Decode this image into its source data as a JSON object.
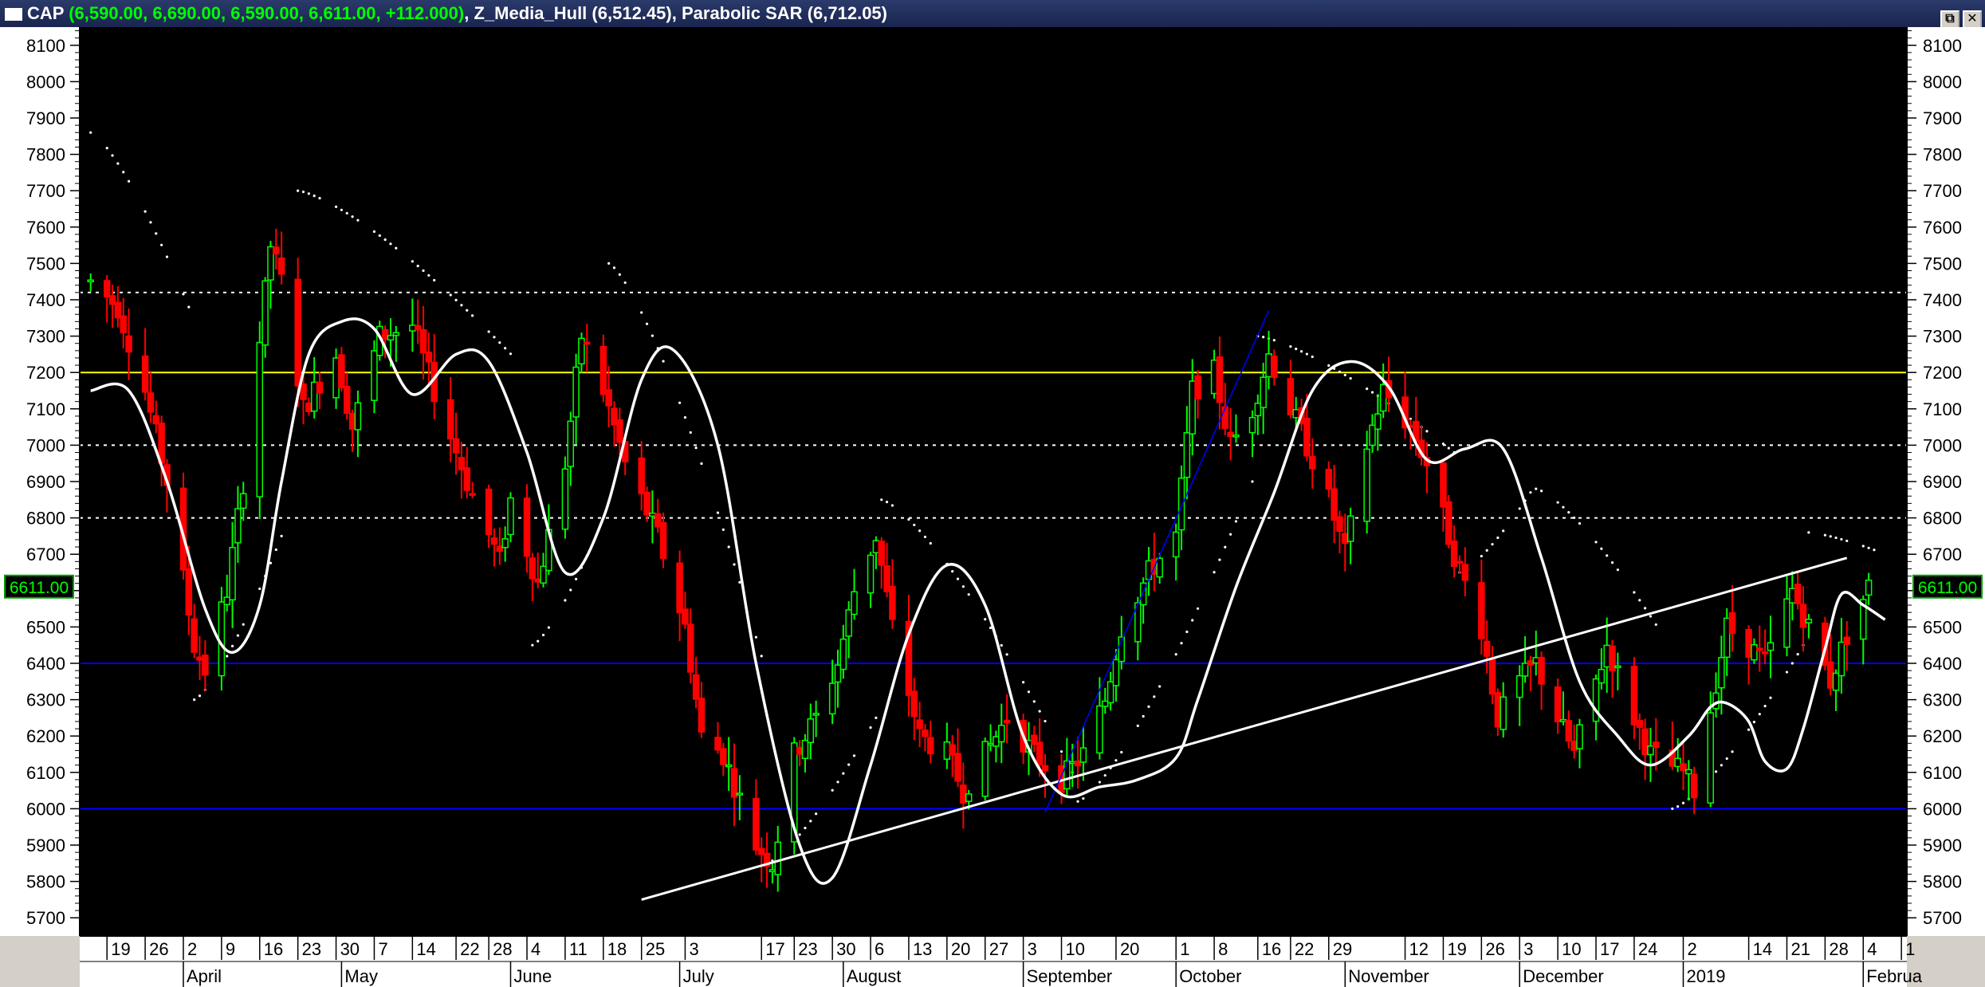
{
  "window": {
    "symbol": "CAP",
    "ohlc_text": "(6,590.00, 6,690.00, 6,590.00, 6,611.00, +112.000)",
    "indicator1_name": "Z_Media_Hull",
    "indicator1_value": "(6,512.45)",
    "indicator2_name": "Parabolic SAR",
    "indicator2_value": "(6,712.05)",
    "separator": ",",
    "restore_glyph": "⧉",
    "close_glyph": "✕"
  },
  "colors": {
    "background": "#000000",
    "up_candle": "#00ff00",
    "down_candle": "#ff0000",
    "hull": "#ffffff",
    "sar": "#ffffff",
    "yellow_line": "#ffff00",
    "blue_line": "#0000ff",
    "trend_line": "#ffffff",
    "price_label_bg": "#00a000"
  },
  "chart_data": {
    "type": "candlestick",
    "ylim": [
      5650,
      8150
    ],
    "y_ticks": [
      5700,
      5800,
      5900,
      6000,
      6100,
      6200,
      6300,
      6400,
      6500,
      6600,
      6700,
      6800,
      6900,
      7000,
      7100,
      7200,
      7300,
      7400,
      7500,
      7600,
      7700,
      7800,
      7900,
      8000,
      8100
    ],
    "last_price_label": "6611.00",
    "last_price": 6611,
    "x_day_labels": [
      {
        "label": "19",
        "date": "2018-03-19"
      },
      {
        "label": "26",
        "date": "2018-03-26"
      },
      {
        "label": "2",
        "date": "2018-04-02"
      },
      {
        "label": "9",
        "date": "2018-04-09"
      },
      {
        "label": "16",
        "date": "2018-04-16"
      },
      {
        "label": "23",
        "date": "2018-04-23"
      },
      {
        "label": "30",
        "date": "2018-04-30"
      },
      {
        "label": "7",
        "date": "2018-05-07"
      },
      {
        "label": "14",
        "date": "2018-05-14"
      },
      {
        "label": "22",
        "date": "2018-05-22"
      },
      {
        "label": "28",
        "date": "2018-05-28"
      },
      {
        "label": "4",
        "date": "2018-06-04"
      },
      {
        "label": "11",
        "date": "2018-06-11"
      },
      {
        "label": "18",
        "date": "2018-06-18"
      },
      {
        "label": "25",
        "date": "2018-06-25"
      },
      {
        "label": "3",
        "date": "2018-07-03"
      },
      {
        "label": "17",
        "date": "2018-07-17"
      },
      {
        "label": "23",
        "date": "2018-07-23"
      },
      {
        "label": "30",
        "date": "2018-07-30"
      },
      {
        "label": "6",
        "date": "2018-08-06"
      },
      {
        "label": "13",
        "date": "2018-08-13"
      },
      {
        "label": "20",
        "date": "2018-08-20"
      },
      {
        "label": "27",
        "date": "2018-08-27"
      },
      {
        "label": "3",
        "date": "2018-09-03"
      },
      {
        "label": "10",
        "date": "2018-09-10"
      },
      {
        "label": "20",
        "date": "2018-09-20"
      },
      {
        "label": "1",
        "date": "2018-10-01"
      },
      {
        "label": "8",
        "date": "2018-10-08"
      },
      {
        "label": "16",
        "date": "2018-10-16"
      },
      {
        "label": "22",
        "date": "2018-10-22"
      },
      {
        "label": "29",
        "date": "2018-10-29"
      },
      {
        "label": "12",
        "date": "2018-11-12"
      },
      {
        "label": "19",
        "date": "2018-11-19"
      },
      {
        "label": "26",
        "date": "2018-11-26"
      },
      {
        "label": "3",
        "date": "2018-12-03"
      },
      {
        "label": "10",
        "date": "2018-12-10"
      },
      {
        "label": "17",
        "date": "2018-12-17"
      },
      {
        "label": "24",
        "date": "2018-12-24"
      },
      {
        "label": "2",
        "date": "2019-01-02"
      },
      {
        "label": "14",
        "date": "2019-01-14"
      },
      {
        "label": "21",
        "date": "2019-01-21"
      },
      {
        "label": "28",
        "date": "2019-01-28"
      },
      {
        "label": "4",
        "date": "2019-02-04"
      },
      {
        "label": "1",
        "date": "2019-02-11"
      }
    ],
    "x_month_labels": [
      {
        "label": "April",
        "date": "2018-04-02"
      },
      {
        "label": "May",
        "date": "2018-05-01"
      },
      {
        "label": "June",
        "date": "2018-06-01"
      },
      {
        "label": "July",
        "date": "2018-07-02"
      },
      {
        "label": "August",
        "date": "2018-08-01"
      },
      {
        "label": "September",
        "date": "2018-09-03"
      },
      {
        "label": "October",
        "date": "2018-10-01"
      },
      {
        "label": "November",
        "date": "2018-11-01"
      },
      {
        "label": "December",
        "date": "2018-12-03"
      },
      {
        "label": "2019",
        "date": "2019-01-02"
      },
      {
        "label": "Februa",
        "date": "2019-02-04"
      }
    ],
    "horizontal_lines": [
      {
        "y": 7420,
        "style": "dotted",
        "color": "#ffffff"
      },
      {
        "y": 7200,
        "style": "solid",
        "color": "#ffff00"
      },
      {
        "y": 7000,
        "style": "dotted",
        "color": "#ffffff"
      },
      {
        "y": 6800,
        "style": "dotted",
        "color": "#ffffff"
      },
      {
        "y": 6400,
        "style": "solid",
        "color": "#0000ff"
      },
      {
        "y": 6000,
        "style": "solid",
        "color": "#0000ff"
      }
    ],
    "trend_lines": [
      {
        "x1": "2018-06-25",
        "y1": 5750,
        "x2": "2019-02-01",
        "y2": 6690,
        "color": "#ffffff",
        "width": 3
      },
      {
        "x1": "2018-09-07",
        "y1": 5990,
        "x2": "2018-10-18",
        "y2": 7370,
        "color": "#0000ff",
        "width": 1.5
      }
    ],
    "hull_keypoints": [
      [
        "2018-03-16",
        7150
      ],
      [
        "2018-03-23",
        7150
      ],
      [
        "2018-03-30",
        6900
      ],
      [
        "2018-04-06",
        6550
      ],
      [
        "2018-04-11",
        6430
      ],
      [
        "2018-04-16",
        6560
      ],
      [
        "2018-04-20",
        6900
      ],
      [
        "2018-04-25",
        7250
      ],
      [
        "2018-05-01",
        7340
      ],
      [
        "2018-05-07",
        7320
      ],
      [
        "2018-05-14",
        7140
      ],
      [
        "2018-05-22",
        7250
      ],
      [
        "2018-05-28",
        7230
      ],
      [
        "2018-06-04",
        6980
      ],
      [
        "2018-06-11",
        6650
      ],
      [
        "2018-06-18",
        6800
      ],
      [
        "2018-06-25",
        7180
      ],
      [
        "2018-07-01",
        7260
      ],
      [
        "2018-07-09",
        7000
      ],
      [
        "2018-07-16",
        6400
      ],
      [
        "2018-07-24",
        5900
      ],
      [
        "2018-07-30",
        5810
      ],
      [
        "2018-08-06",
        6120
      ],
      [
        "2018-08-13",
        6480
      ],
      [
        "2018-08-20",
        6670
      ],
      [
        "2018-08-27",
        6560
      ],
      [
        "2018-09-03",
        6200
      ],
      [
        "2018-09-10",
        6040
      ],
      [
        "2018-09-17",
        6060
      ],
      [
        "2018-09-24",
        6080
      ],
      [
        "2018-10-01",
        6140
      ],
      [
        "2018-10-05",
        6300
      ],
      [
        "2018-10-12",
        6610
      ],
      [
        "2018-10-19",
        6870
      ],
      [
        "2018-10-26",
        7150
      ],
      [
        "2018-11-02",
        7230
      ],
      [
        "2018-11-09",
        7160
      ],
      [
        "2018-11-16",
        6960
      ],
      [
        "2018-11-23",
        6990
      ],
      [
        "2018-11-30",
        6990
      ],
      [
        "2018-12-07",
        6690
      ],
      [
        "2018-12-14",
        6350
      ],
      [
        "2018-12-21",
        6200
      ],
      [
        "2018-12-27",
        6120
      ],
      [
        "2019-01-03",
        6200
      ],
      [
        "2019-01-07",
        6280
      ],
      [
        "2019-01-10",
        6290
      ],
      [
        "2019-01-14",
        6240
      ],
      [
        "2019-01-17",
        6130
      ],
      [
        "2019-01-21",
        6110
      ],
      [
        "2019-01-24",
        6220
      ],
      [
        "2019-01-28",
        6440
      ],
      [
        "2019-01-31",
        6590
      ],
      [
        "2019-02-04",
        6560
      ],
      [
        "2019-02-08",
        6520
      ]
    ],
    "sar_segments": [
      {
        "from": "2018-03-16",
        "to": "2018-04-03",
        "start": 7860,
        "end": 7380
      },
      {
        "from": "2018-04-04",
        "to": "2018-04-20",
        "start": 6300,
        "end": 6750
      },
      {
        "from": "2018-04-23",
        "to": "2018-06-03",
        "start": 7700,
        "end": 7220
      },
      {
        "from": "2018-06-05",
        "to": "2018-06-18",
        "start": 6450,
        "end": 6800
      },
      {
        "from": "2018-06-19",
        "to": "2018-07-17",
        "start": 7500,
        "end": 6420
      },
      {
        "from": "2018-07-18",
        "to": "2018-08-07",
        "start": 5850,
        "end": 6250
      },
      {
        "from": "2018-08-08",
        "to": "2018-09-12",
        "start": 6850,
        "end": 6100
      },
      {
        "from": "2018-09-13",
        "to": "2018-10-15",
        "start": 6020,
        "end": 6900
      },
      {
        "from": "2018-10-16",
        "to": "2018-11-21",
        "start": 7300,
        "end": 6980
      },
      {
        "from": "2018-11-22",
        "to": "2018-12-05",
        "start": 6650,
        "end": 6870
      },
      {
        "from": "2018-12-06",
        "to": "2018-12-30",
        "start": 6880,
        "end": 6460
      },
      {
        "from": "2018-12-31",
        "to": "2019-01-24",
        "start": 6000,
        "end": 6450
      },
      {
        "from": "2019-01-25",
        "to": "2019-02-06",
        "start": 6760,
        "end": 6712
      }
    ],
    "pivots": [
      [
        "2018-03-16",
        7450
      ],
      [
        "2018-03-21",
        7380
      ],
      [
        "2018-03-26",
        7150
      ],
      [
        "2018-03-30",
        6900
      ],
      [
        "2018-04-04",
        6450
      ],
      [
        "2018-04-06",
        6380
      ],
      [
        "2018-04-10",
        6600
      ],
      [
        "2018-04-13",
        6900
      ],
      [
        "2018-04-18",
        7550
      ],
      [
        "2018-04-20",
        7450
      ],
      [
        "2018-04-24",
        7100
      ],
      [
        "2018-04-30",
        7250
      ],
      [
        "2018-05-03",
        7050
      ],
      [
        "2018-05-08",
        7300
      ],
      [
        "2018-05-14",
        7330
      ],
      [
        "2018-05-18",
        7150
      ],
      [
        "2018-05-24",
        6900
      ],
      [
        "2018-05-30",
        6680
      ],
      [
        "2018-06-01",
        6850
      ],
      [
        "2018-06-06",
        6620
      ],
      [
        "2018-06-11",
        6950
      ],
      [
        "2018-06-14",
        7300
      ],
      [
        "2018-06-18",
        7150
      ],
      [
        "2018-06-22",
        6950
      ],
      [
        "2018-06-28",
        6750
      ],
      [
        "2018-07-03",
        6500
      ],
      [
        "2018-07-06",
        6200
      ],
      [
        "2018-07-10",
        6150
      ],
      [
        "2018-07-16",
        5900
      ],
      [
        "2018-07-19",
        5850
      ],
      [
        "2018-07-23",
        6150
      ],
      [
        "2018-07-27",
        6250
      ],
      [
        "2018-07-31",
        6400
      ],
      [
        "2018-08-03",
        6600
      ],
      [
        "2018-08-07",
        6750
      ],
      [
        "2018-08-10",
        6500
      ],
      [
        "2018-08-15",
        6200
      ],
      [
        "2018-08-20",
        6150
      ],
      [
        "2018-08-23",
        6050
      ],
      [
        "2018-08-27",
        6150
      ],
      [
        "2018-08-31",
        6250
      ],
      [
        "2018-09-05",
        6150
      ],
      [
        "2018-09-10",
        6080
      ],
      [
        "2018-09-14",
        6150
      ],
      [
        "2018-09-18",
        6300
      ],
      [
        "2018-09-21",
        6500
      ],
      [
        "2018-09-26",
        6650
      ],
      [
        "2018-10-01",
        6750
      ],
      [
        "2018-10-04",
        7150
      ],
      [
        "2018-10-08",
        7200
      ],
      [
        "2018-10-11",
        7000
      ],
      [
        "2018-10-15",
        7100
      ],
      [
        "2018-10-18",
        7250
      ],
      [
        "2018-10-22",
        7100
      ],
      [
        "2018-10-25",
        7000
      ],
      [
        "2018-10-29",
        6850
      ],
      [
        "2018-11-01",
        6700
      ],
      [
        "2018-11-05",
        7000
      ],
      [
        "2018-11-08",
        7150
      ],
      [
        "2018-11-13",
        7050
      ],
      [
        "2018-11-16",
        6950
      ],
      [
        "2018-11-21",
        6700
      ],
      [
        "2018-11-26",
        6500
      ],
      [
        "2018-11-29",
        6250
      ],
      [
        "2018-12-03",
        6350
      ],
      [
        "2018-12-06",
        6400
      ],
      [
        "2018-12-10",
        6250
      ],
      [
        "2018-12-13",
        6150
      ],
      [
        "2018-12-17",
        6350
      ],
      [
        "2018-12-19",
        6450
      ],
      [
        "2018-12-24",
        6250
      ],
      [
        "2018-12-27",
        6150
      ],
      [
        "2019-01-02",
        6100
      ],
      [
        "2019-01-04",
        6050
      ],
      [
        "2019-01-08",
        6350
      ],
      [
        "2019-01-10",
        6500
      ],
      [
        "2019-01-14",
        6450
      ],
      [
        "2019-01-17",
        6400
      ],
      [
        "2019-01-22",
        6600
      ],
      [
        "2019-01-25",
        6500
      ],
      [
        "2019-01-29",
        6350
      ],
      [
        "2019-02-01",
        6480
      ],
      [
        "2019-02-05",
        6611
      ]
    ]
  }
}
